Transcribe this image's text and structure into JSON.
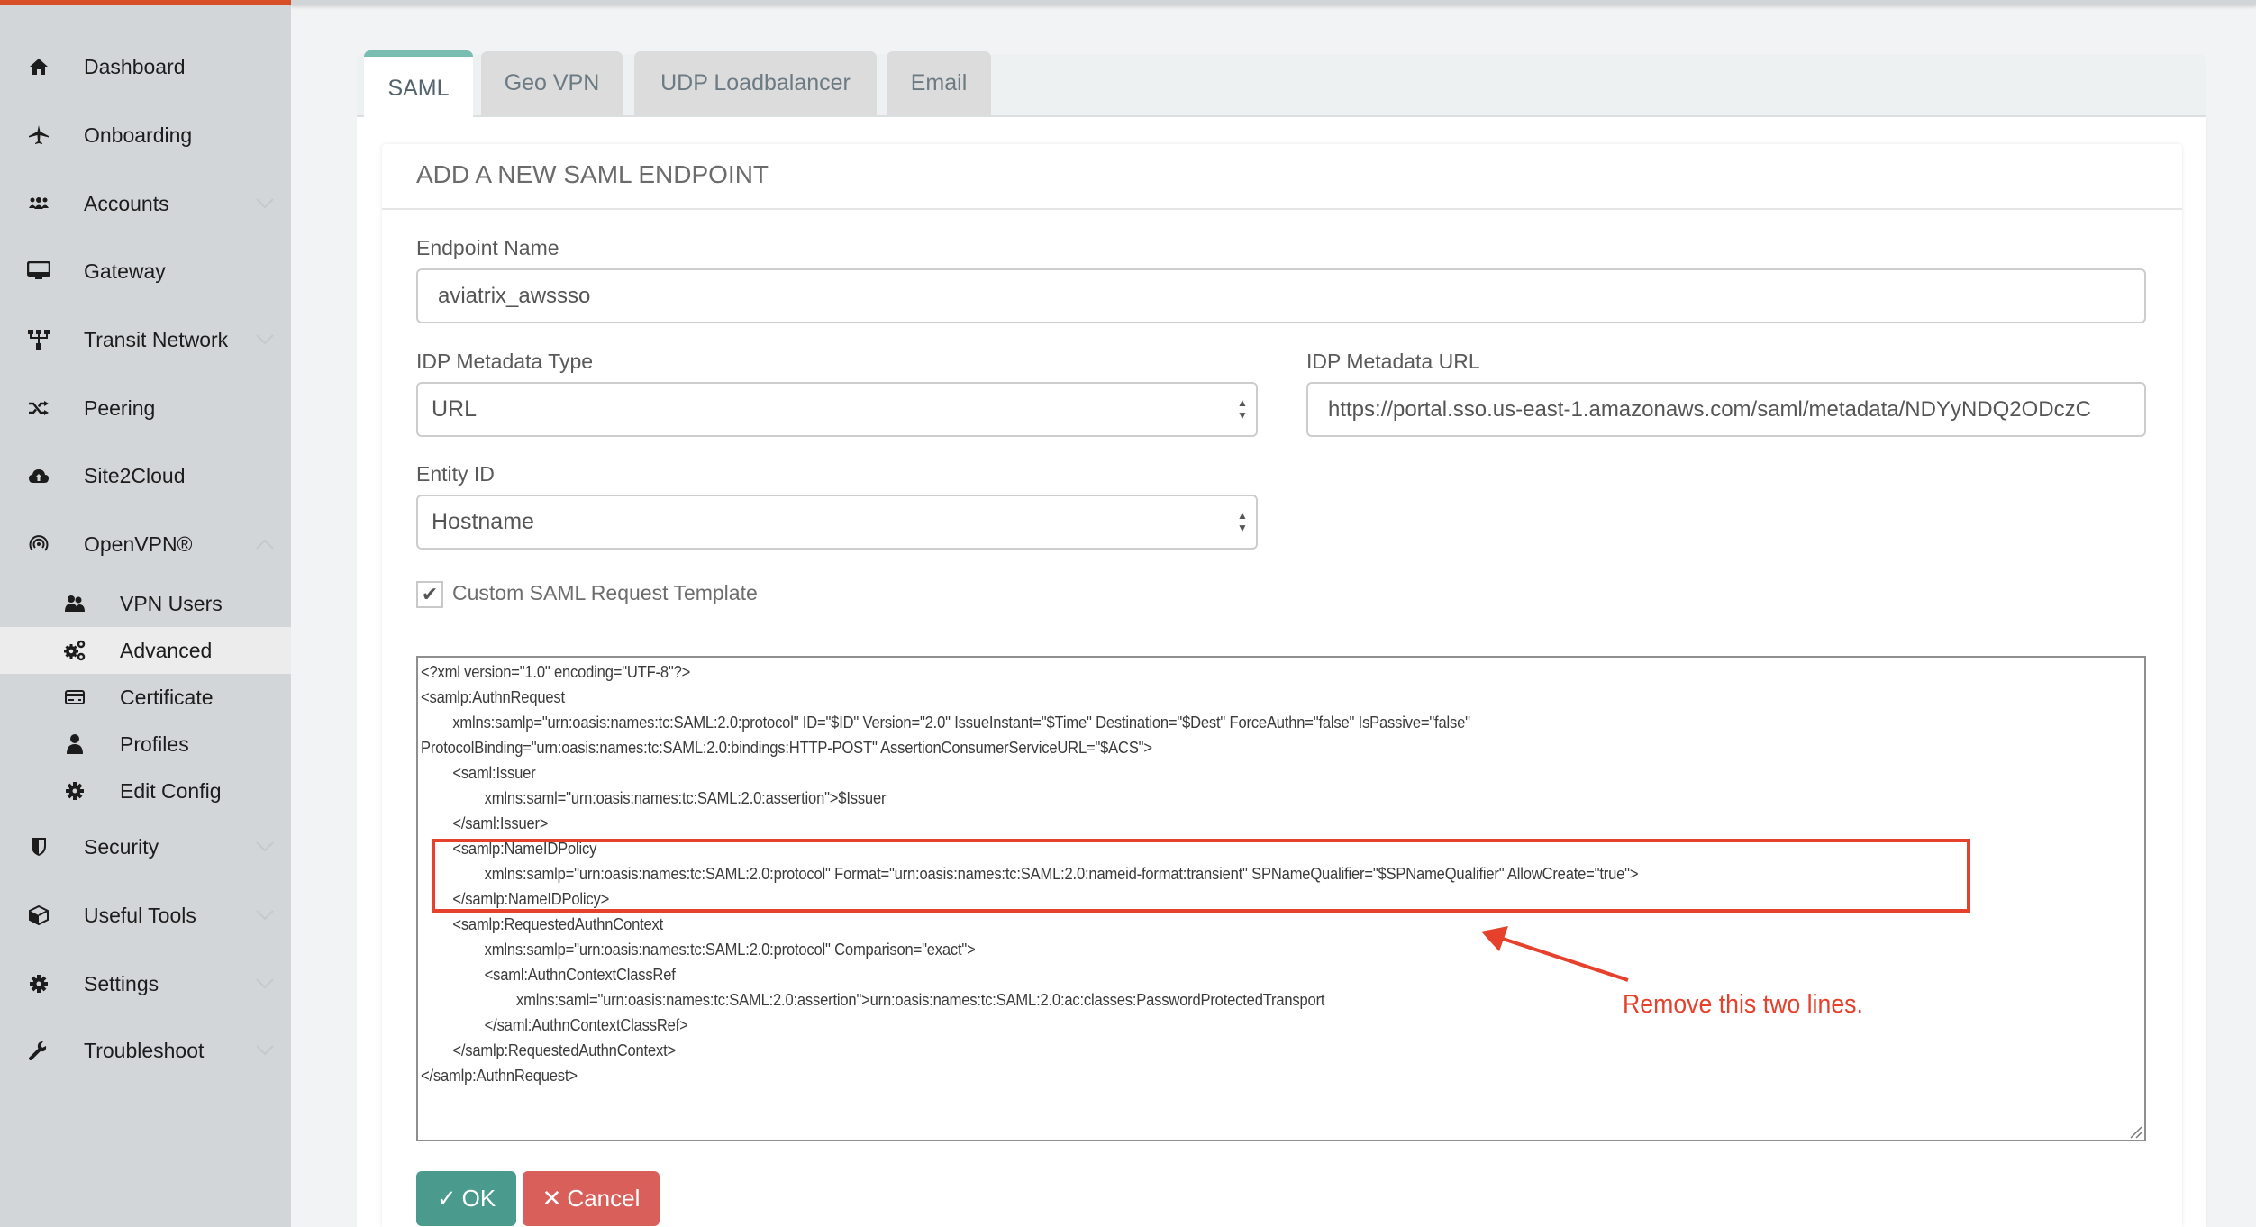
{
  "sidebar": {
    "items": [
      {
        "label": "Dashboard",
        "icon": "home-icon",
        "has_chevron": false
      },
      {
        "label": "Onboarding",
        "icon": "airplane-icon",
        "has_chevron": false
      },
      {
        "label": "Accounts",
        "icon": "users-group-icon",
        "has_chevron": true
      },
      {
        "label": "Gateway",
        "icon": "monitor-icon",
        "has_chevron": false
      },
      {
        "label": "Transit Network",
        "icon": "network-tree-icon",
        "has_chevron": true
      },
      {
        "label": "Peering",
        "icon": "shuffle-icon",
        "has_chevron": false
      },
      {
        "label": "Site2Cloud",
        "icon": "cloud-upload-icon",
        "has_chevron": false
      },
      {
        "label": "OpenVPN®",
        "icon": "broadcast-icon",
        "has_chevron": true,
        "expanded": true
      },
      {
        "label": "Security",
        "icon": "shield-icon",
        "has_chevron": true
      },
      {
        "label": "Useful Tools",
        "icon": "cube-icon",
        "has_chevron": true
      },
      {
        "label": "Settings",
        "icon": "gear-icon",
        "has_chevron": true
      },
      {
        "label": "Troubleshoot",
        "icon": "wrench-icon",
        "has_chevron": true
      }
    ],
    "openvpn_subitems": [
      {
        "label": "VPN Users",
        "icon": "users-icon"
      },
      {
        "label": "Advanced",
        "icon": "gears-icon",
        "active": true
      },
      {
        "label": "Certificate",
        "icon": "credit-card-icon"
      },
      {
        "label": "Profiles",
        "icon": "user-icon"
      },
      {
        "label": "Edit Config",
        "icon": "gear-icon"
      }
    ]
  },
  "tabs": [
    {
      "label": "SAML",
      "active": true
    },
    {
      "label": "Geo VPN",
      "active": false
    },
    {
      "label": "UDP Loadbalancer",
      "active": false
    },
    {
      "label": "Email",
      "active": false
    }
  ],
  "form": {
    "title": "ADD A NEW SAML ENDPOINT",
    "endpoint_name": {
      "label": "Endpoint Name",
      "value": "aviatrix_awssso"
    },
    "idp_metadata_type": {
      "label": "IDP Metadata Type",
      "value": "URL"
    },
    "idp_metadata_url": {
      "label": "IDP Metadata URL",
      "value": "https://portal.sso.us-east-1.amazonaws.com/saml/metadata/NDYyNDQ2ODczC"
    },
    "entity_id": {
      "label": "Entity ID",
      "value": "Hostname"
    },
    "custom_template": {
      "label": "Custom SAML Request Template",
      "checked": true
    },
    "template_lines": [
      "<?xml version=\"1.0\" encoding=\"UTF-8\"?>",
      "<samlp:AuthnRequest",
      "        xmlns:samlp=\"urn:oasis:names:tc:SAML:2.0:protocol\" ID=\"$ID\" Version=\"2.0\" IssueInstant=\"$Time\" Destination=\"$Dest\" ForceAuthn=\"false\" IsPassive=\"false\"",
      "ProtocolBinding=\"urn:oasis:names:tc:SAML:2.0:bindings:HTTP-POST\" AssertionConsumerServiceURL=\"$ACS\">",
      "        <saml:Issuer",
      "                xmlns:saml=\"urn:oasis:names:tc:SAML:2.0:assertion\">$Issuer",
      "        </saml:Issuer>",
      "        <samlp:NameIDPolicy",
      "                xmlns:samlp=\"urn:oasis:names:tc:SAML:2.0:protocol\" Format=\"urn:oasis:names:tc:SAML:2.0:nameid-format:transient\" SPNameQualifier=\"$SPNameQualifier\" AllowCreate=\"true\">",
      "        </samlp:NameIDPolicy>",
      "        <samlp:RequestedAuthnContext",
      "                xmlns:samlp=\"urn:oasis:names:tc:SAML:2.0:protocol\" Comparison=\"exact\">",
      "                <saml:AuthnContextClassRef",
      "                        xmlns:saml=\"urn:oasis:names:tc:SAML:2.0:assertion\">urn:oasis:names:tc:SAML:2.0:ac:classes:PasswordProtectedTransport",
      "                </saml:AuthnContextClassRef>",
      "        </samlp:RequestedAuthnContext>",
      "</samlp:AuthnRequest>"
    ],
    "ok_label": "OK",
    "cancel_label": "Cancel"
  },
  "annotation": {
    "text": "Remove this two lines.",
    "color": "#e5412c"
  },
  "colors": {
    "brand_orange": "#d84f27",
    "tab_accent": "#79bdb2",
    "ok_button": "#4a9b8e",
    "cancel_button": "#d9605a"
  }
}
